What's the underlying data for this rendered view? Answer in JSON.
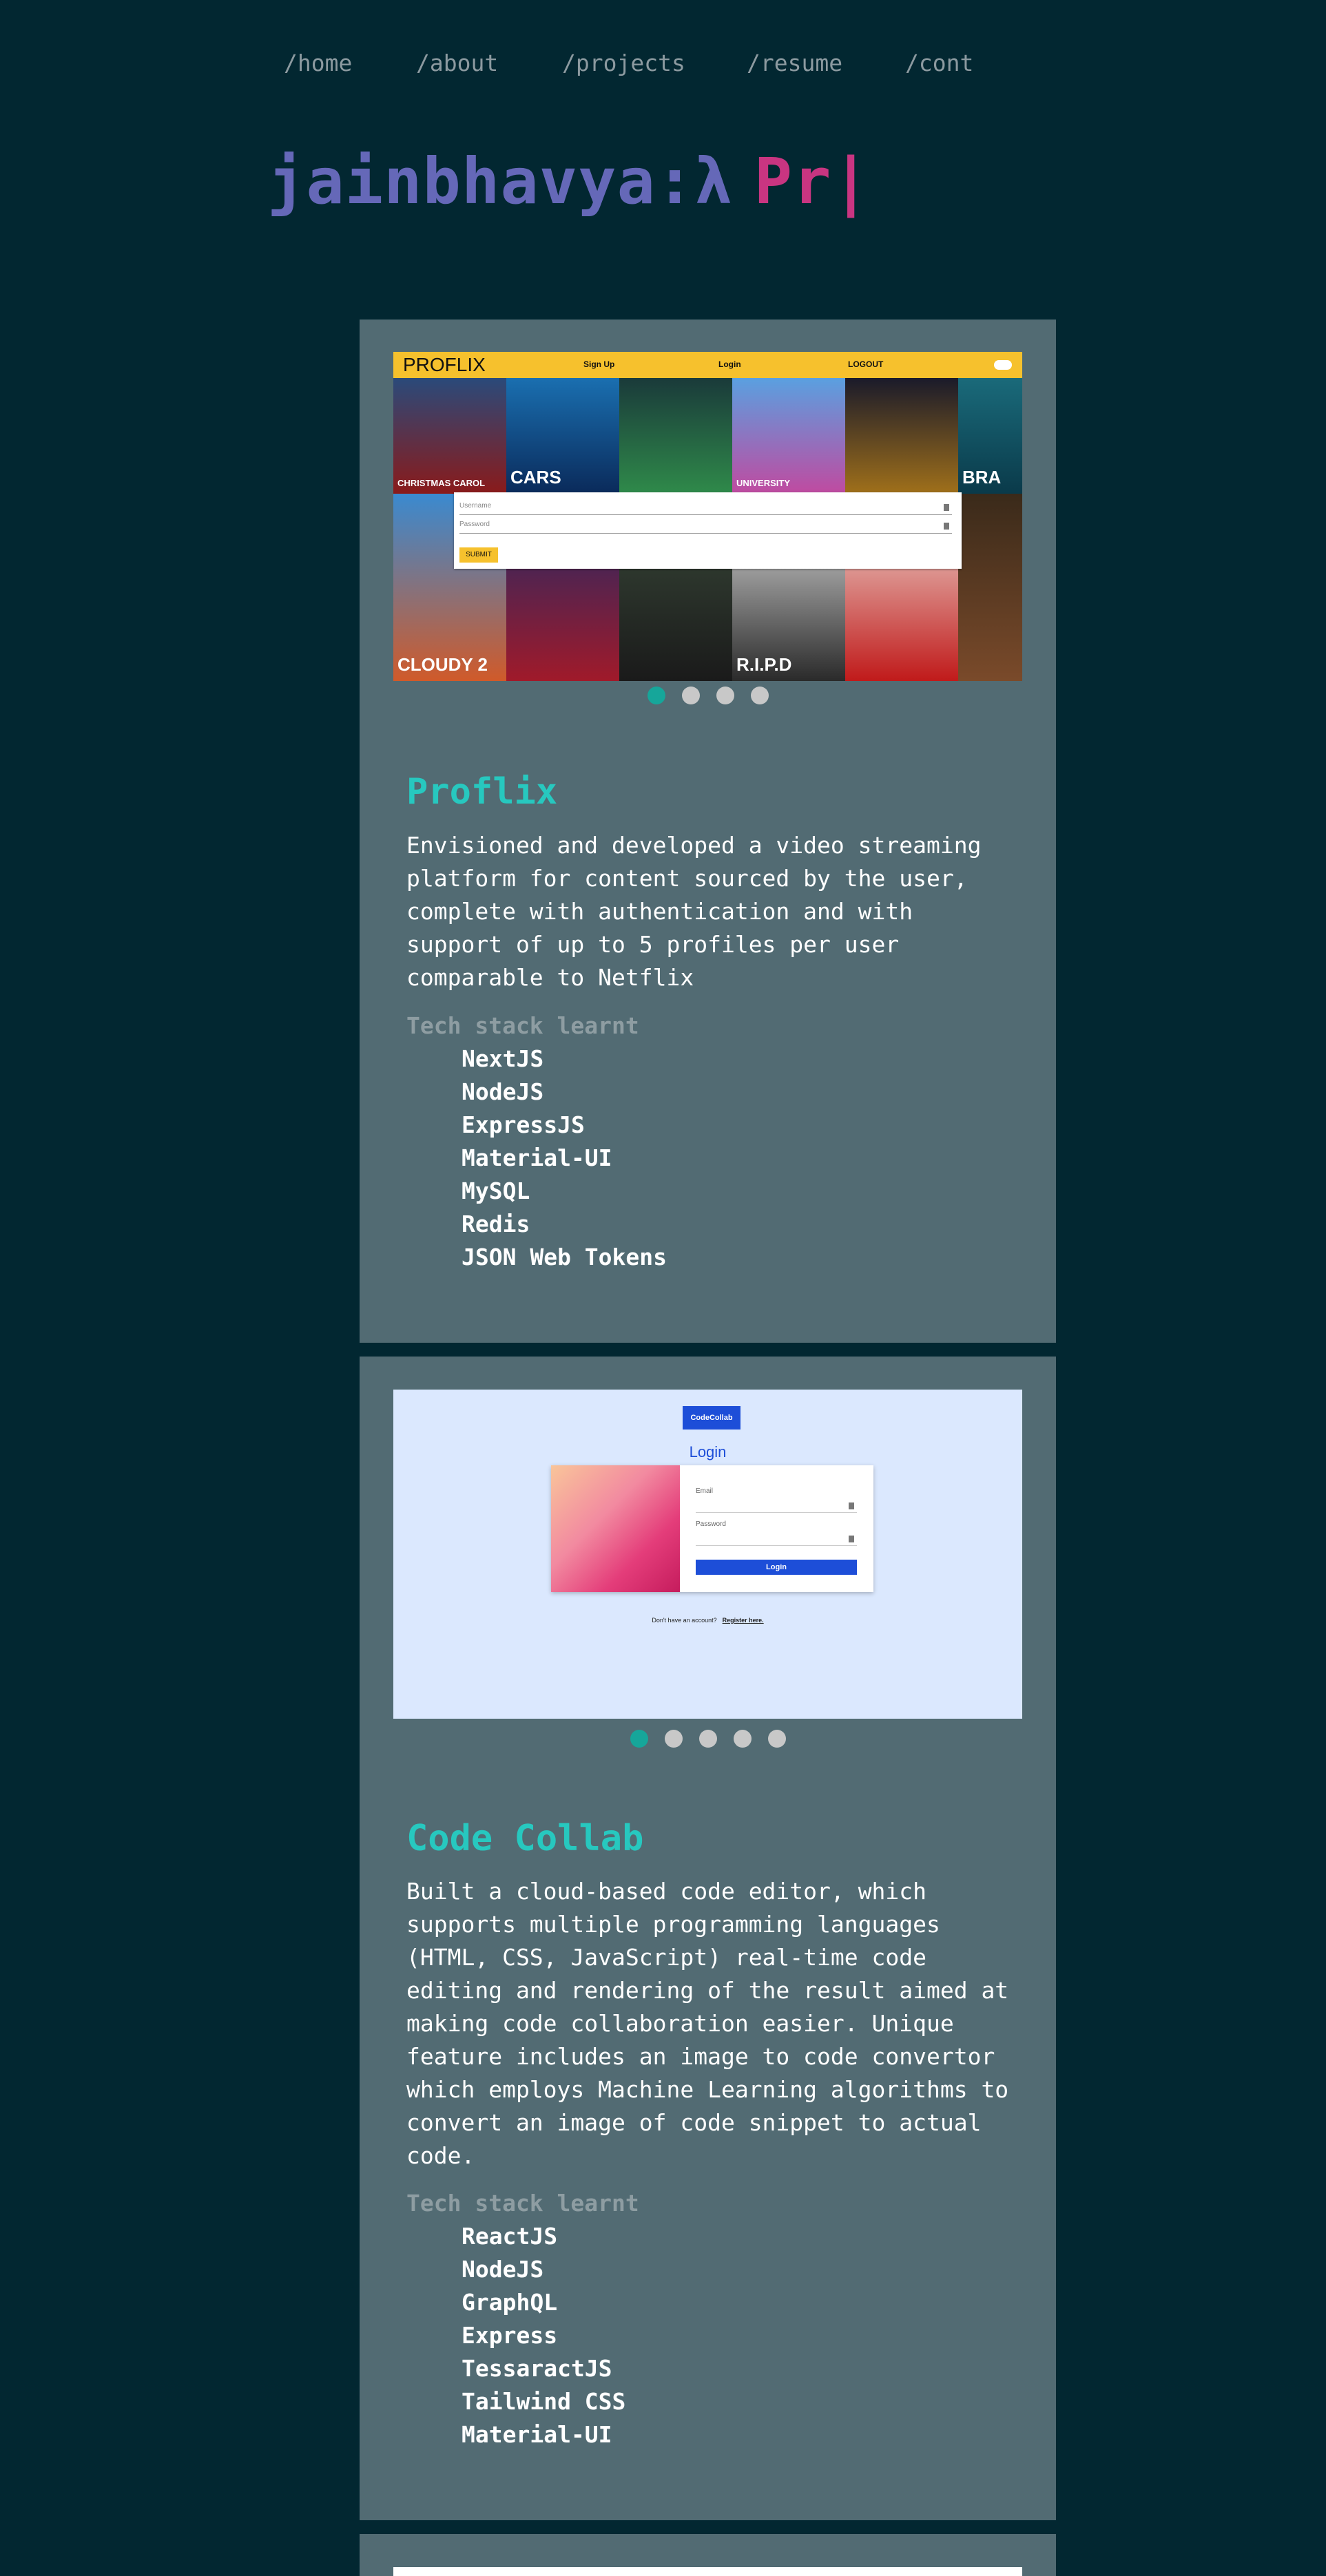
{
  "nav": {
    "items": [
      "/home",
      "/about",
      "/projects",
      "/resume",
      "/cont"
    ]
  },
  "hero": {
    "name": "jainbhavya:λ",
    "typed": "Pr|"
  },
  "colors": {
    "background": "#022731",
    "card": "#526b73",
    "accent_teal": "#27c8bf",
    "name_purple": "#6568b8",
    "typed_pink": "#c93581"
  },
  "projects": [
    {
      "title": "Proflix",
      "description": "Envisioned and developed a video streaming platform for content sourced by the user, complete with authentication and with support of up to 5 profiles per user comparable to Netflix",
      "stack_label": "Tech stack learnt",
      "stack": [
        "NextJS",
        "NodeJS",
        "ExpressJS",
        "Material-UI",
        "MySQL",
        "Redis",
        "JSON Web Tokens"
      ],
      "carousel_total": 4,
      "carousel_active": 1,
      "screenshot": {
        "logo": "PROFLIX",
        "links": [
          "Sign Up",
          "Login",
          "LOGOUT"
        ],
        "username_placeholder": "Username",
        "password_placeholder": "Password",
        "submit": "SUBMIT",
        "poster_texts": [
          "CHRISTMAS CAROL",
          "CARS",
          "",
          "UNIVERSITY",
          "",
          "BRA",
          "CLOUDY 2",
          "",
          "",
          "R.I.P.D",
          "",
          ""
        ]
      }
    },
    {
      "title": "Code Collab",
      "description": "Built a cloud-based code editor, which supports multiple programming languages (HTML, CSS, JavaScript) real-time code editing and rendering of the result aimed at making code collaboration easier. Unique feature includes an image to code convertor which employs Machine Learning algorithms to convert an image of code snippet to actual code.",
      "stack_label": "Tech stack learnt",
      "stack": [
        "ReactJS",
        "NodeJS",
        "GraphQL",
        "Express",
        "TessaractJS",
        "Tailwind CSS",
        "Material-UI"
      ],
      "carousel_total": 5,
      "carousel_active": 1,
      "screenshot": {
        "logo": "CodeCollab",
        "heading": "Login",
        "email_label": "Email",
        "password_label": "Password",
        "button": "Login",
        "footer_text": "Don't have an account?",
        "footer_link": "Register here."
      }
    }
  ]
}
